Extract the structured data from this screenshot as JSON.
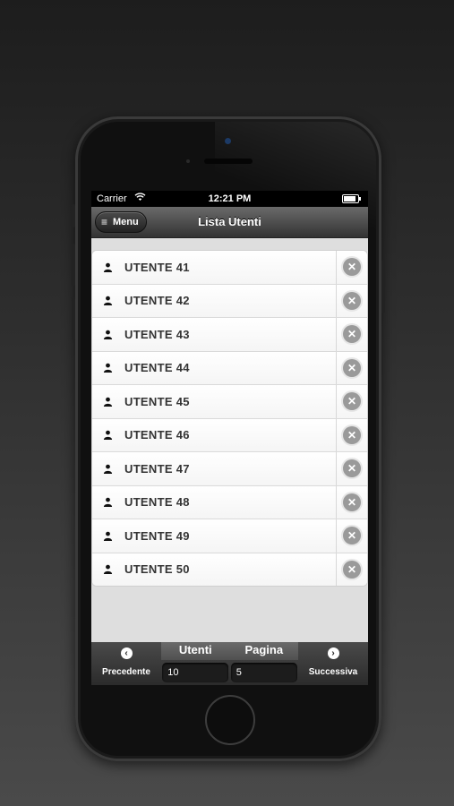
{
  "status_bar": {
    "carrier": "Carrier",
    "time": "12:21 PM",
    "battery_level": 0.85
  },
  "header": {
    "menu_label": "Menu",
    "title": "Lista Utenti"
  },
  "users": [
    {
      "label": "UTENTE 41"
    },
    {
      "label": "UTENTE 42"
    },
    {
      "label": "UTENTE 43"
    },
    {
      "label": "UTENTE 44"
    },
    {
      "label": "UTENTE 45"
    },
    {
      "label": "UTENTE 46"
    },
    {
      "label": "UTENTE 47"
    },
    {
      "label": "UTENTE 48"
    },
    {
      "label": "UTENTE 49"
    },
    {
      "label": "UTENTE 50"
    }
  ],
  "footer": {
    "prev_label": "Precedente",
    "next_label": "Successiva",
    "users_label": "Utenti",
    "users_value": "10",
    "page_label": "Pagina",
    "page_value": "5"
  },
  "icons": {
    "menu": "hamburger-icon",
    "user": "user-icon",
    "delete": "delete-icon",
    "prev": "chevron-left-icon",
    "next": "chevron-right-icon"
  }
}
